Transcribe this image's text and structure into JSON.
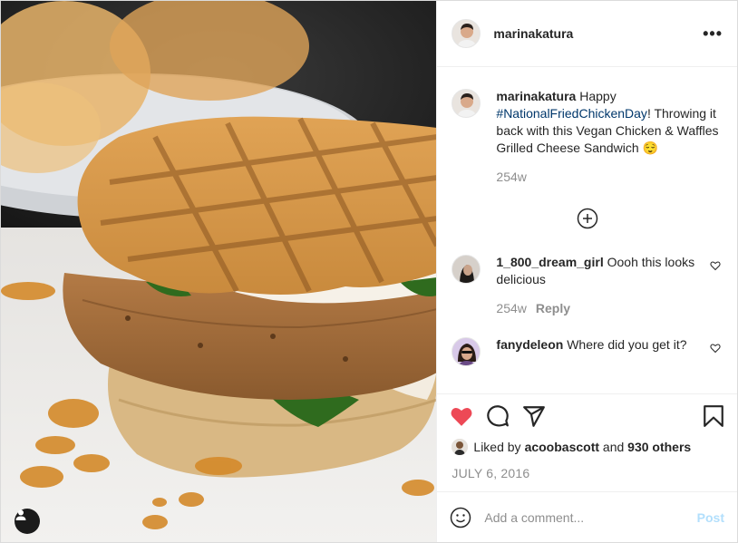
{
  "post": {
    "author": "marinakatura",
    "more_icon": "more-horizontal-icon",
    "caption": {
      "username": "marinakatura",
      "text_before": " Happy ",
      "hashtag": "#NationalFriedChickenDay",
      "text_after": "! Throwing it back with this Vegan Chicken & Waffles Grilled Cheese Sandwich 😌",
      "age": "254w"
    },
    "comments": [
      {
        "username": "1_800_dream_girl",
        "text": " Oooh this looks delicious",
        "age": "254w",
        "reply_label": "Reply"
      },
      {
        "username": "fanydeleon",
        "text": " Where did you get it?"
      }
    ],
    "likes": {
      "prefix": "Liked by ",
      "user": "acoobascott",
      "middle": " and ",
      "count": "930 others"
    },
    "date": "JULY 6, 2016",
    "comment_box": {
      "placeholder": "Add a comment...",
      "post_label": "Post"
    },
    "colors": {
      "heart_liked": "#ed4956",
      "hashtag": "#00376b",
      "post_button_disabled": "#b2dffc"
    }
  }
}
